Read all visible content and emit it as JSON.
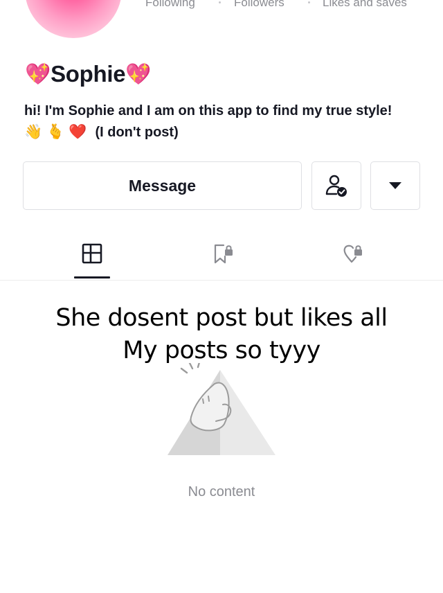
{
  "profile": {
    "stats": [
      {
        "label": "Following"
      },
      {
        "label": "Followers"
      },
      {
        "label": "Likes and saves"
      }
    ],
    "name_emoji_left": "💖",
    "name": "Sophie",
    "name_emoji_right": "💖",
    "bio_line1": "hi! I'm Sophie and I am on this app to find my true style!",
    "bio_emojis": [
      "👋",
      "🫰",
      "❤️"
    ],
    "bio_line2_text": "(I don't post)"
  },
  "actions": {
    "message_label": "Message",
    "friend_icon": "person-check-icon",
    "more_icon": "caret-down-icon"
  },
  "tabs": [
    {
      "icon": "grid-icon",
      "active": true
    },
    {
      "icon": "bookmark-lock-icon",
      "active": false
    },
    {
      "icon": "heart-lock-icon",
      "active": false
    }
  ],
  "overlay_caption": {
    "line1": "She dosent post but likes all",
    "line2": "My posts so tyyy"
  },
  "empty_state": {
    "icon": "empty-mountain-illustration",
    "text": "No content"
  },
  "colors": {
    "text": "#161823",
    "secondary": "#8a8b91",
    "border": "#dedfe3",
    "avatar_pink": "#ff62a0"
  }
}
